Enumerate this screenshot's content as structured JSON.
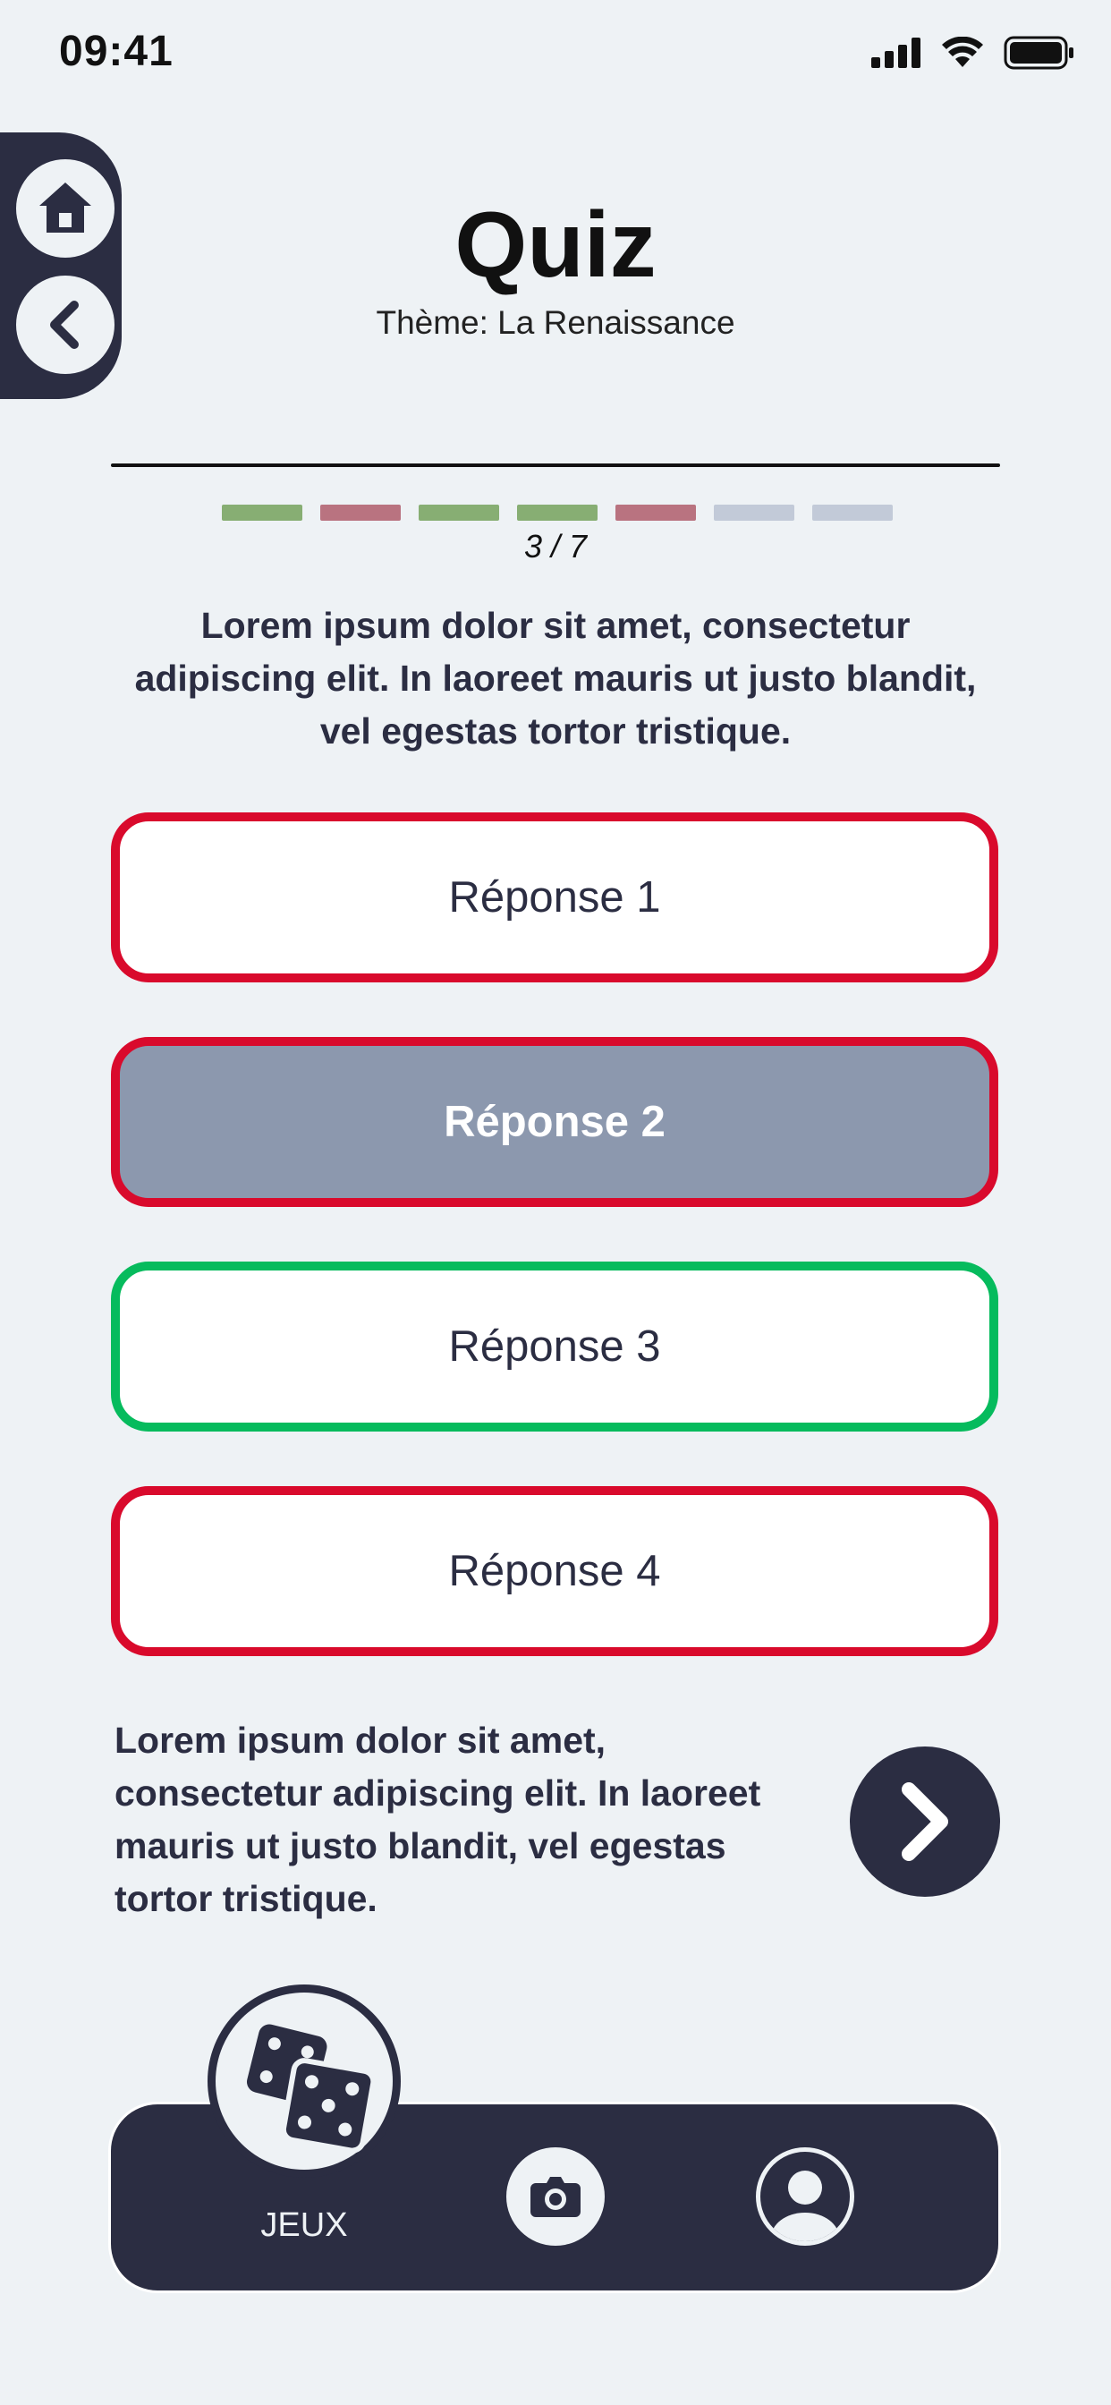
{
  "status_bar": {
    "time": "09:41"
  },
  "header": {
    "title": "Quiz",
    "subtitle": "Thème: La Renaissance"
  },
  "progress": {
    "current": 3,
    "total": 7,
    "label": "3 / 7",
    "segments": [
      {
        "state": "correct",
        "color": "#87ae73"
      },
      {
        "state": "wrong",
        "color": "#b97380"
      },
      {
        "state": "correct",
        "color": "#87ae73"
      },
      {
        "state": "correct",
        "color": "#87ae73"
      },
      {
        "state": "wrong",
        "color": "#b97380"
      },
      {
        "state": "pending",
        "color": "#c2cad8"
      },
      {
        "state": "pending",
        "color": "#c2cad8"
      }
    ]
  },
  "question": "Lorem ipsum dolor sit amet, consectetur adipiscing elit. In laoreet mauris ut justo blandit, vel egestas tortor tristique.",
  "answers": [
    {
      "label": "Réponse 1",
      "state": "wrong"
    },
    {
      "label": "Réponse 2",
      "state": "wrong-selected"
    },
    {
      "label": "Réponse 3",
      "state": "correct"
    },
    {
      "label": "Réponse 4",
      "state": "wrong"
    }
  ],
  "explanation": "Lorem ipsum dolor sit amet, consectetur adipiscing elit. In laoreet mauris ut justo blandit, vel egestas tortor tristique.",
  "nav": {
    "games_label": "JEUX",
    "icons": [
      "dice-icon",
      "camera-icon",
      "profile-icon"
    ]
  },
  "side_panel": {
    "icons": [
      "home-icon",
      "chevron-left-icon"
    ]
  },
  "colors": {
    "dark": "#2b2d42",
    "background": "#eef2f5",
    "wrong": "#d90a2c",
    "correct": "#06bb5d",
    "selected": "#8c98ae"
  }
}
